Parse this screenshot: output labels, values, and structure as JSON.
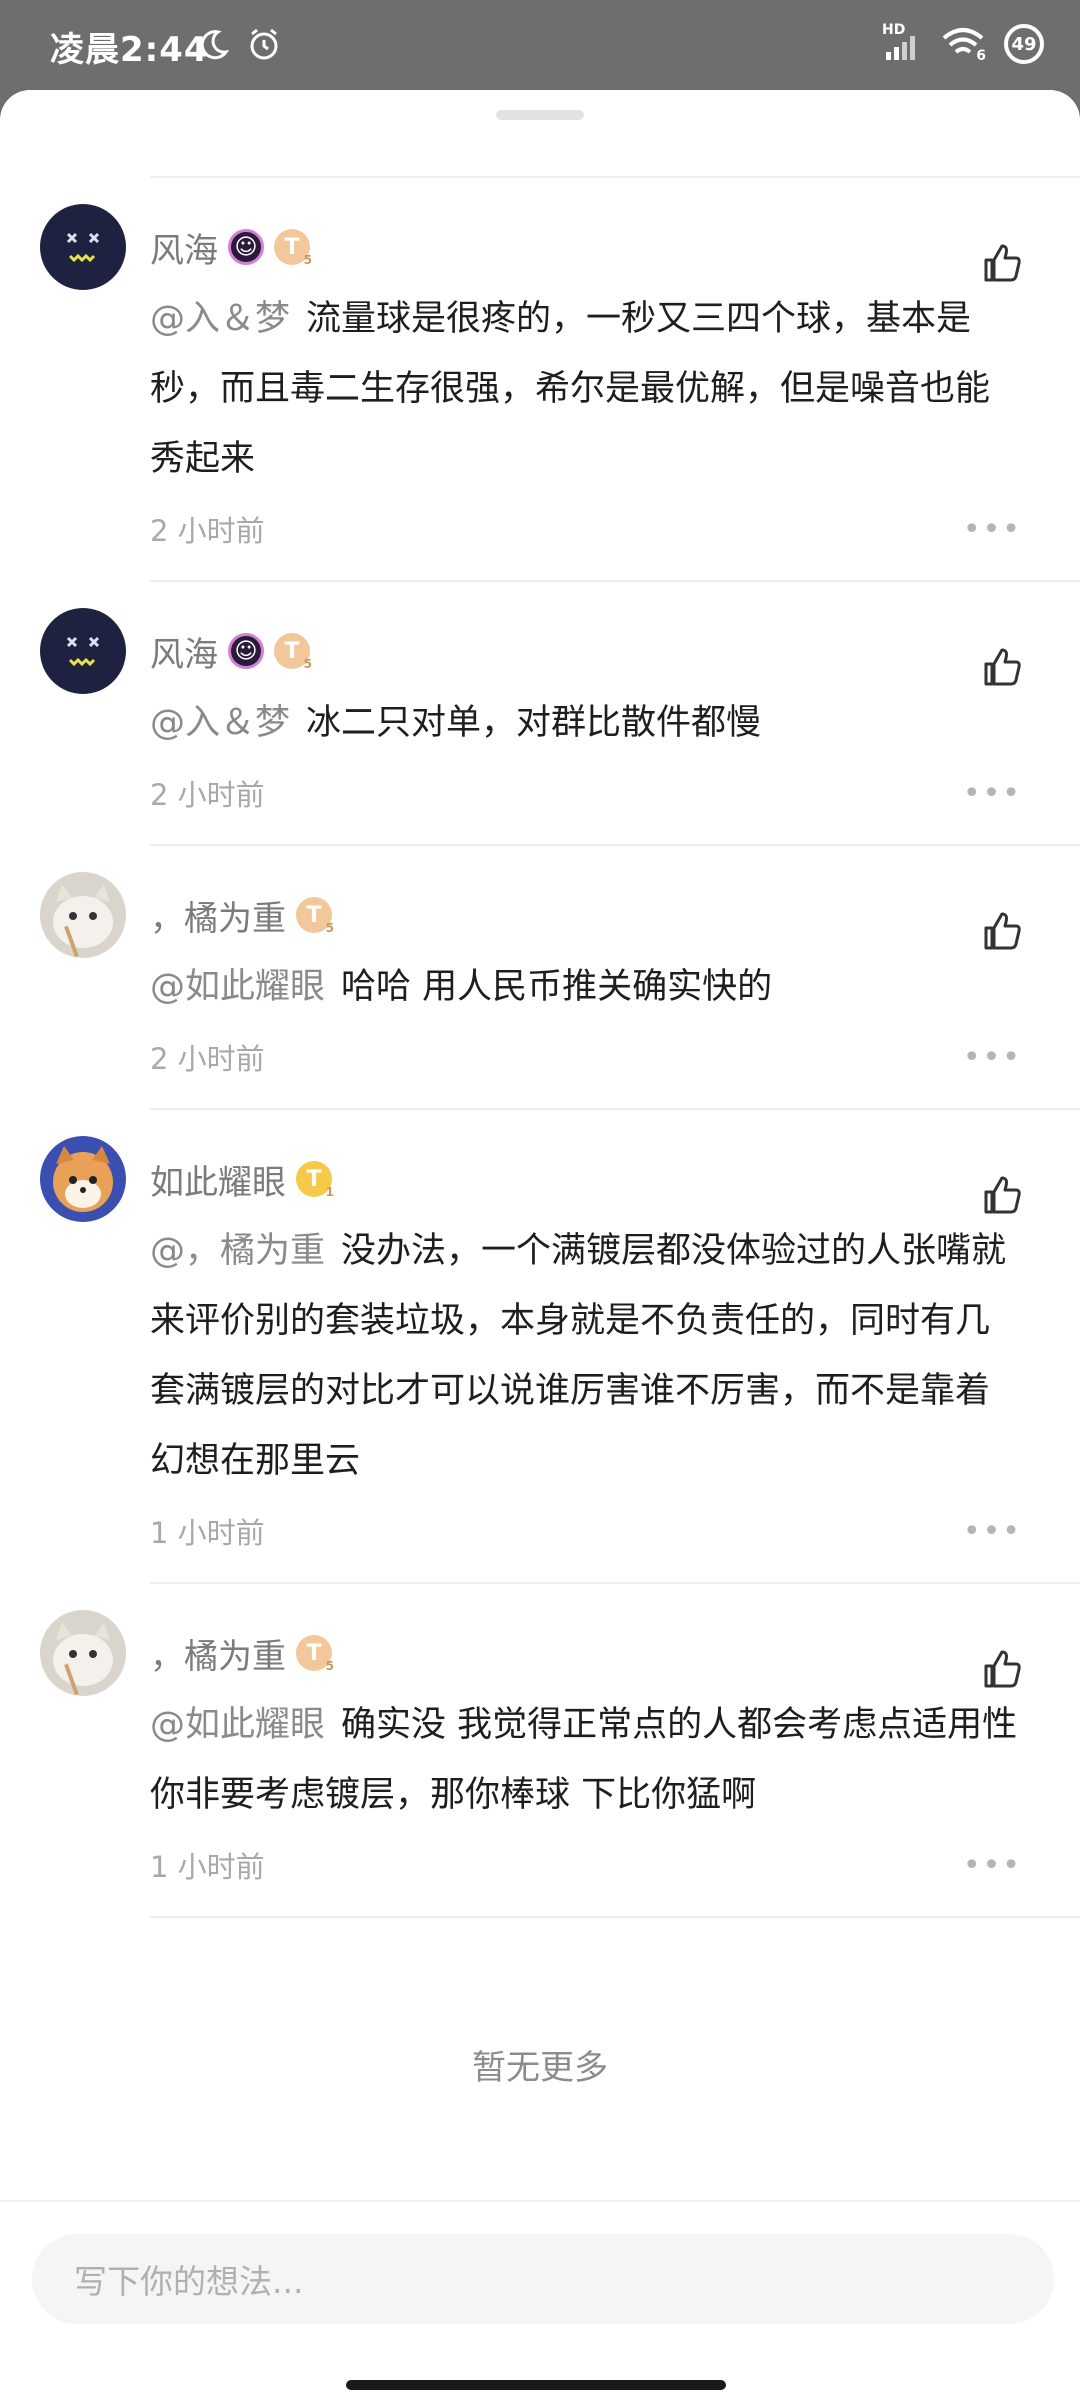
{
  "status": {
    "time": "凌晨2:44",
    "network": "HD",
    "wifi_label": "6",
    "battery": "49",
    "icons": [
      "moon-icon",
      "alarm-icon",
      "signal-icon",
      "wifi-icon",
      "battery-icon"
    ]
  },
  "comments": [
    {
      "name": "风海",
      "badges": [
        "emoji",
        "T5"
      ],
      "mention": "@入＆梦",
      "text": "流量球是很疼的，一秒又三四个球，基本是秒，而且毒二生存很强，希尔是最优解，但是噪音也能秀起来",
      "time": "2 小时前"
    },
    {
      "name": "风海",
      "badges": [
        "emoji",
        "T5"
      ],
      "mention": "@入＆梦",
      "text": "冰二只对单，对群比散件都慢",
      "time": "2 小时前"
    },
    {
      "name": "，橘为重",
      "badges": [
        "T5"
      ],
      "mention": "@如此耀眼",
      "text": "哈哈 用人民币推关确实快的",
      "time": "2 小时前"
    },
    {
      "name": "如此耀眼",
      "badges": [
        "T1"
      ],
      "mention": "@，橘为重",
      "text": "没办法，一个满镀层都没体验过的人张嘴就来评价别的套装垃圾，本身就是不负责任的，同时有几套满镀层的对比才可以说谁厉害谁不厉害，而不是靠着幻想在那里云",
      "time": "1 小时前"
    },
    {
      "name": "，橘为重",
      "badges": [
        "T5"
      ],
      "mention": "@如此耀眼",
      "text": "确实没 我觉得正常点的人都会考虑点适用性 你非要考虑镀层，那你棒球 下比你猛啊",
      "time": "1 小时前"
    }
  ],
  "no_more": "暂无更多",
  "input": {
    "placeholder": "写下你的想法..."
  },
  "colors": {
    "accent_gold": "#f7c948",
    "bronze": "#f2c89a",
    "text_muted": "#8a8a8a"
  }
}
